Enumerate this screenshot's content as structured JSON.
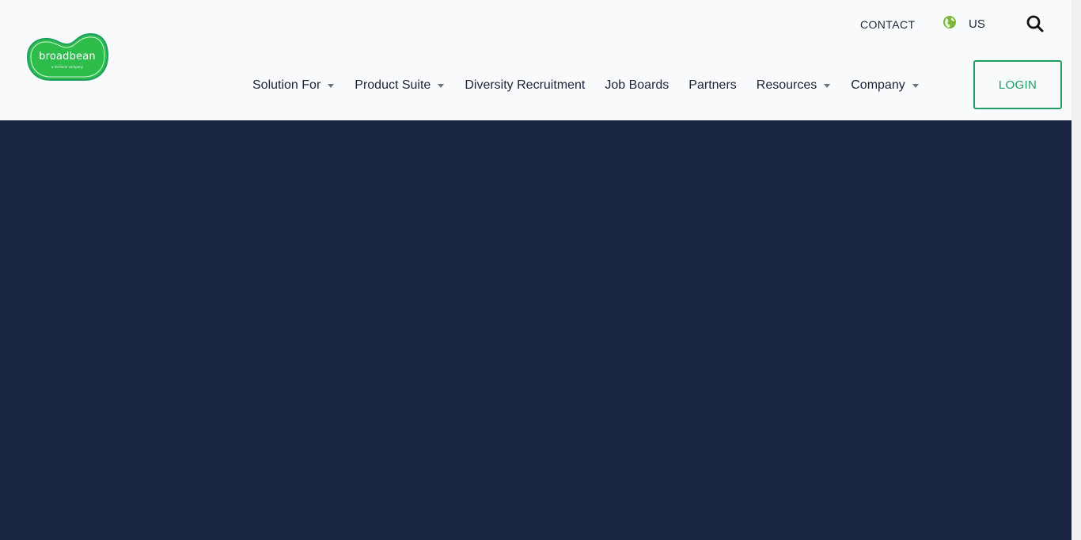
{
  "brand": {
    "name": "broadbean",
    "tagline": "a Veritone company",
    "colors": {
      "logo_green": "#2ebd4a",
      "accent_green": "#1f9d63",
      "hero_navy": "#182440",
      "text_dark": "#1c2437"
    }
  },
  "utility": {
    "contact_label": "CONTACT",
    "region_icon": "globe-icon",
    "region_label": "US",
    "search_icon": "search-icon"
  },
  "nav": {
    "items": [
      {
        "label": "Solution For",
        "has_dropdown": true
      },
      {
        "label": "Product Suite",
        "has_dropdown": true
      },
      {
        "label": "Diversity Recruitment",
        "has_dropdown": false
      },
      {
        "label": "Job Boards",
        "has_dropdown": false
      },
      {
        "label": "Partners",
        "has_dropdown": false
      },
      {
        "label": "Resources",
        "has_dropdown": true
      },
      {
        "label": "Company",
        "has_dropdown": true
      }
    ],
    "login_label": "LOGIN"
  }
}
